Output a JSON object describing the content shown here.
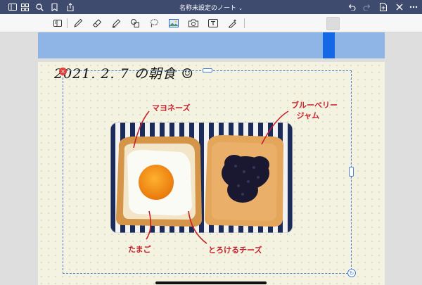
{
  "header": {
    "title": "名称未設定のノート",
    "title_chevron": "⌄"
  },
  "toolbar": {
    "tools": [
      "view-icon",
      "pen-icon",
      "eraser-icon",
      "highlighter-icon",
      "shapes-icon",
      "lasso-icon",
      "image-icon",
      "camera-icon",
      "text-icon",
      "laser-pointer-icon"
    ]
  },
  "note": {
    "date_heading": "2021. 2. 7 の朝食 ☺",
    "annotations": {
      "mayonnaise": "マヨネーズ",
      "blueberry_jam": "ブルーベリー\n  ジャム",
      "egg": "たまご",
      "melting_cheese": "とろけるチーズ"
    }
  },
  "colors": {
    "topbar": "#3e4a6e",
    "annotation_red": "#c7202b",
    "selection_blue": "#4b7fd1",
    "page_bg": "#f4f3e1",
    "prev_page_blue": "#8fb4e6"
  }
}
